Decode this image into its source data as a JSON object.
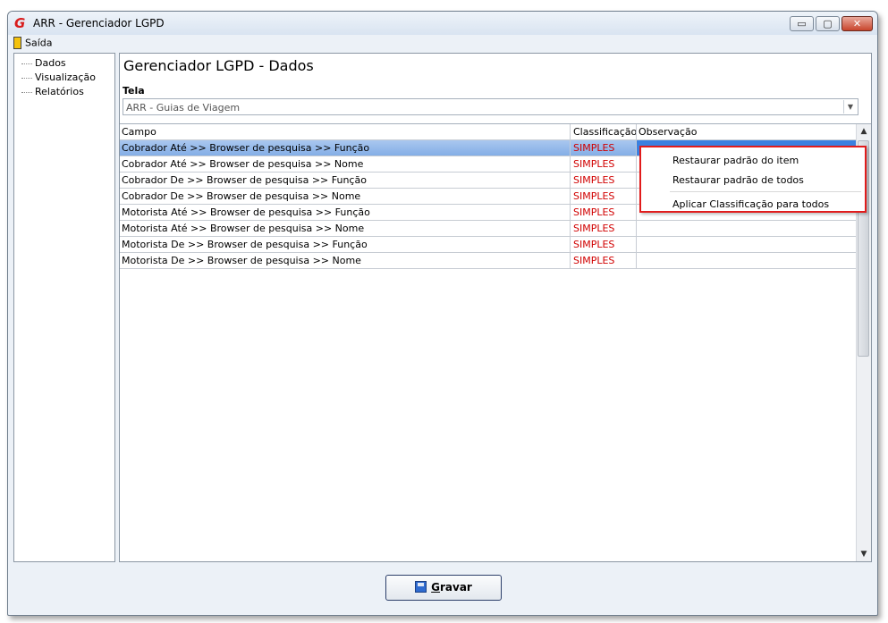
{
  "window": {
    "title": "ARR - Gerenciador LGPD",
    "controls": {
      "minimize": "▭",
      "maximize": "▢",
      "close": "✕"
    }
  },
  "menu": {
    "exit_label": "Saída"
  },
  "tree": {
    "items": [
      {
        "label": "Dados"
      },
      {
        "label": "Visualização"
      },
      {
        "label": "Relatórios"
      }
    ]
  },
  "main": {
    "title": "Gerenciador LGPD - Dados",
    "tela_label": "Tela",
    "tela_value": "ARR - Guias de Viagem",
    "combo_arrow": "▼"
  },
  "grid": {
    "headers": [
      "Campo",
      "Classificação",
      "Observação"
    ],
    "rows": [
      {
        "campo": "Cobrador Até >> Browser de pesquisa >> Função",
        "classificacao": "SIMPLES",
        "observacao": ""
      },
      {
        "campo": "Cobrador Até >> Browser de pesquisa >> Nome",
        "classificacao": "SIMPLES",
        "observacao": ""
      },
      {
        "campo": "Cobrador De >> Browser de pesquisa >> Função",
        "classificacao": "SIMPLES",
        "observacao": ""
      },
      {
        "campo": "Cobrador De >> Browser de pesquisa >> Nome",
        "classificacao": "SIMPLES",
        "observacao": ""
      },
      {
        "campo": "Motorista Até >> Browser de pesquisa >> Função",
        "classificacao": "SIMPLES",
        "observacao": ""
      },
      {
        "campo": "Motorista Até >> Browser de pesquisa >> Nome",
        "classificacao": "SIMPLES",
        "observacao": ""
      },
      {
        "campo": "Motorista De >> Browser de pesquisa >> Função",
        "classificacao": "SIMPLES",
        "observacao": ""
      },
      {
        "campo": "Motorista De >> Browser de pesquisa >> Nome",
        "classificacao": "SIMPLES",
        "observacao": ""
      }
    ],
    "scroll_up": "▲",
    "scroll_down": "▼"
  },
  "context_menu": {
    "items": [
      "Restaurar padrão do item",
      "Restaurar padrão de todos",
      "Aplicar Classificação para todos"
    ]
  },
  "footer": {
    "save_label_first": "G",
    "save_label_rest": "ravar"
  },
  "colors": {
    "classification": "#d10000",
    "selection": "#84aee6",
    "highlight_border": "#e11c1c"
  }
}
